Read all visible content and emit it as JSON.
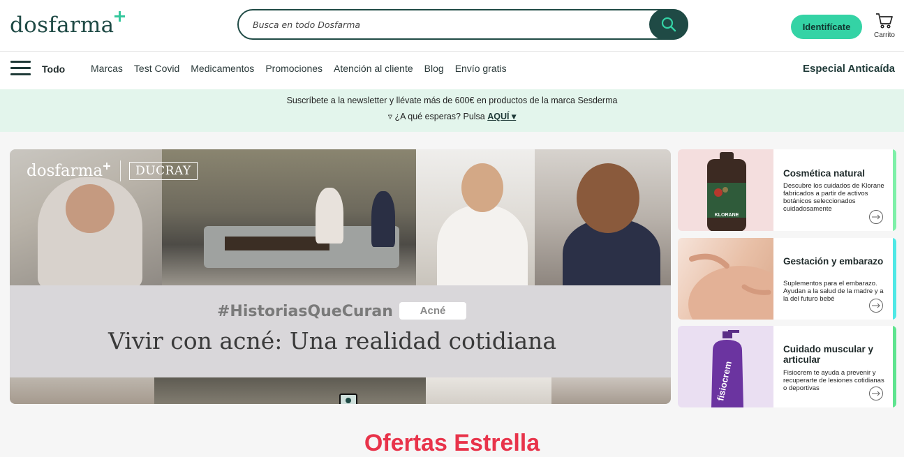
{
  "header": {
    "logo": "dosfarma",
    "search_placeholder": "Busca en todo Dosfarma",
    "login_label": "Identifícate",
    "cart_label": "Carrito"
  },
  "nav": {
    "all_label": "Todo",
    "links": [
      "Marcas",
      "Test Covid",
      "Medicamentos",
      "Promociones",
      "Atención al cliente",
      "Blog",
      "Envío gratis"
    ],
    "special": "Especial Anticaída"
  },
  "newsletter": {
    "line1": "Suscríbete a la newsletter y llévate más de 600€ en productos de la marca Sesderma",
    "line2_prefix": "▿ ¿A qué esperas? Pulsa",
    "link": "AQUÍ ▾"
  },
  "hero": {
    "logo": "dosfarma",
    "partner": "DUCRAY",
    "hashtag": "#HistoriasQueCuran",
    "tag": "Acné",
    "headline": "Vivir con acné: Una realidad cotidiana"
  },
  "cards": [
    {
      "title": "Cosmética natural",
      "desc": "Descubre los cuidados de Klorane fabricados a partir de activos botánicos seleccionados cuidadosamente",
      "accent": "#7ef0a8",
      "bg": "#f4dede",
      "product_label": "KLORANE"
    },
    {
      "title": "Gestación y embarazo",
      "desc": "Suplementos para el embarazo. Ayudan a la salud de la madre y a la del futuro bebé",
      "accent": "#4fe8e6",
      "bg": "#efd3c4"
    },
    {
      "title": "Cuidado muscular y articular",
      "desc": "Fisiocrem te ayuda a prevenir y recuperarte de lesiones cotidianas o deportivas",
      "accent": "#5ee48f",
      "bg": "#eadff2",
      "product_label": "fisiocrem"
    }
  ],
  "section_title": "Ofertas Estrella",
  "colors": {
    "brand_dark": "#1f4a45",
    "brand_green": "#34d3a5",
    "newsletter_bg": "#e3f5ec",
    "offers_red": "#e8334a"
  }
}
